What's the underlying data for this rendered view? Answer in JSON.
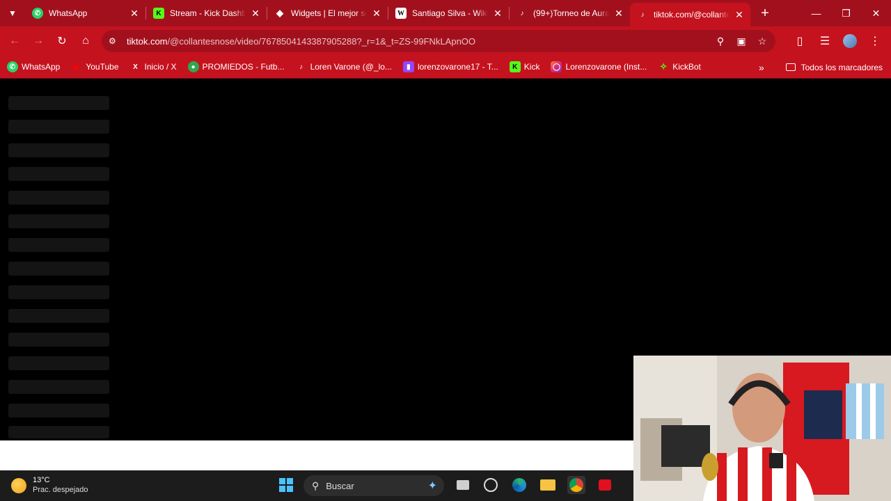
{
  "browser": {
    "tabs": [
      {
        "title": "WhatsApp",
        "icon": "whatsapp-icon",
        "color": "#25d366",
        "active": false
      },
      {
        "title": "Stream - Kick Dashbo",
        "icon": "kick-icon",
        "color": "#53fc18",
        "active": false
      },
      {
        "title": "Widgets | El mejor so",
        "icon": "widgets-icon",
        "color": "#ffffff",
        "active": false
      },
      {
        "title": "Santiago Silva - Wiki",
        "icon": "wikipedia-icon",
        "color": "#ffffff",
        "active": false
      },
      {
        "title": "(99+)Torneo de Aura",
        "icon": "tiktok-icon",
        "color": "#000000",
        "active": false
      },
      {
        "title": "tiktok.com/@collante",
        "icon": "tiktok-icon",
        "color": "#000000",
        "active": true
      }
    ],
    "url_host": "tiktok.com",
    "url_path": "/@collantesnose/video/7678504143387905288?_r=1&_t=ZS-99FNkLApnOO",
    "bookmarks": [
      {
        "label": "WhatsApp",
        "icon": "whatsapp-icon",
        "color": "#25d366"
      },
      {
        "label": "YouTube",
        "icon": "youtube-icon",
        "color": "#ff0000"
      },
      {
        "label": "Inicio / X",
        "icon": "x-icon",
        "color": "#000000"
      },
      {
        "label": "PROMIEDOS - Futb...",
        "icon": "promiedos-icon",
        "color": "#2fa84f"
      },
      {
        "label": "Loren Varone (@_lo...",
        "icon": "tiktok-icon",
        "color": "#000000"
      },
      {
        "label": "lorenzovarone17 - T...",
        "icon": "twitch-icon",
        "color": "#9146ff"
      },
      {
        "label": "Kick",
        "icon": "kick-icon",
        "color": "#53fc18"
      },
      {
        "label": "Lorenzovarone (Inst...",
        "icon": "instagram-icon",
        "color": "#e1306c"
      },
      {
        "label": "KickBot",
        "icon": "kickbot-icon",
        "color": "#53fc18"
      }
    ],
    "all_bookmarks_label": "Todos los marcadores",
    "theme_color": "#c5121f"
  },
  "taskbar": {
    "temperature": "13°C",
    "weather_condition": "Prac. despejado",
    "search_placeholder": "Buscar"
  }
}
